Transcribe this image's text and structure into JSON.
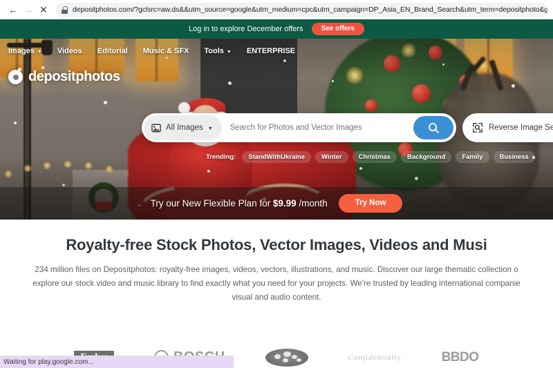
{
  "browser": {
    "back_icon": "back-arrow-icon",
    "forward_icon": "forward-arrow-icon",
    "stop_icon": "stop-x-icon",
    "lock_icon": "lock-icon",
    "url": "depositphotos.com/?gclsrc=aw.ds&&utm_source=google&utm_medium=cpc&utm_campaign=DP_Asia_EN_Brand_Search&utm_term=depositphoto&gclid=CjwKCAiA-dCc",
    "status_text": "Waiting for play.google.com..."
  },
  "top_banner": {
    "message": "Log in to explore December offers",
    "cta_label": "See offers",
    "bg_color": "#0d5a44",
    "cta_color": "#ef5340"
  },
  "site_nav": {
    "items": [
      {
        "label": "Images",
        "has_caret": true
      },
      {
        "label": "Videos",
        "has_caret": false
      },
      {
        "label": "Editorial",
        "has_caret": false
      },
      {
        "label": "Music & SFX",
        "has_caret": false
      },
      {
        "label": "Tools",
        "has_caret": true
      },
      {
        "label": "ENTERPRISE",
        "has_caret": false
      }
    ]
  },
  "logo": {
    "text": "depositphotos",
    "mark_icon": "depositphotos-circle-logo-icon"
  },
  "search": {
    "scope_label": "All Images",
    "scope_icon": "image-icon",
    "caret_icon": "chevron-down-icon",
    "placeholder": "Search for Photos and Vector Images",
    "value": "",
    "button_icon": "search-icon",
    "button_color": "#3b8fd4",
    "reverse_label": "Reverse Image Search",
    "reverse_icon": "reverse-image-search-icon"
  },
  "trending": {
    "label": "Trending:",
    "tags": [
      "StandWithUkraine",
      "Winter",
      "Christmas",
      "Background",
      "Family",
      "Business"
    ]
  },
  "promo": {
    "text_prefix": "Try our New Flexible Plan for ",
    "price": "$9.99",
    "text_suffix": " /month",
    "cta_label": "Try Now",
    "cta_color": "#f4603f"
  },
  "main": {
    "heading": "Royalty-free Stock Photos, Vector Images, Videos and Musi",
    "paragraph": "234 million files on Depositphotos: royalty-free images, videos, vectors, illustrations, and music. Discover our large thematic collection o explore our stock video and music library to find exactly what you need for your projects. We're trusted by leading international companie visual and audio content."
  },
  "brands": {
    "items": [
      {
        "name": "Forbes",
        "label": "Forbes"
      },
      {
        "name": "Bosch",
        "label": "BOSCH"
      },
      {
        "name": "Subaru",
        "label": ""
      },
      {
        "name": "Script",
        "label": "Confidentially"
      },
      {
        "name": "BBDO",
        "label": "BBDO"
      }
    ]
  }
}
